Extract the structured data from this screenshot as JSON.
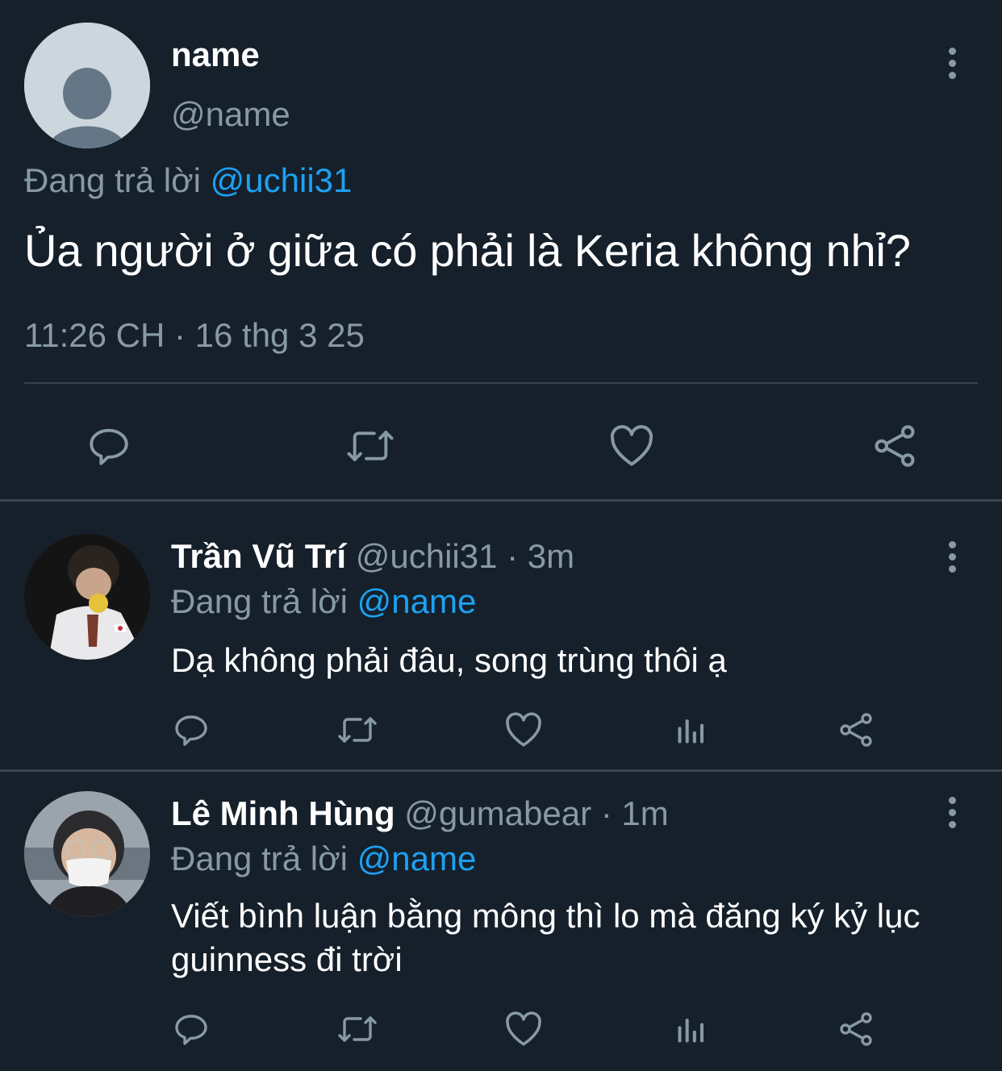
{
  "main_tweet": {
    "display_name": "name",
    "handle": "@name",
    "replying_prefix": "Đang trả lời",
    "replying_to": "@uchii31",
    "text": "Ủa người ở giữa có phải là Keria không nhỉ?",
    "timestamp": "11:26 CH · 16 thg 3 25",
    "actions": [
      "reply-icon",
      "retweet-icon",
      "like-icon",
      "share-icon"
    ]
  },
  "replies": [
    {
      "display_name": "Trần Vũ Trí",
      "handle": "@uchii31",
      "time": "· 3m",
      "replying_prefix": "Đang trả lời",
      "replying_to": "@name",
      "text": "Dạ không phải đâu, song trùng thôi ạ",
      "actions": [
        "reply-icon",
        "retweet-icon",
        "like-icon",
        "analytics-icon",
        "share-icon"
      ]
    },
    {
      "display_name": "Lê Minh Hùng",
      "handle": "@gumabear",
      "time": "· 1m",
      "replying_prefix": "Đang trả lời",
      "replying_to": "@name",
      "text": "Viết bình luận bằng mông thì lo mà đăng ký kỷ lục guinness đi trời",
      "actions": [
        "reply-icon",
        "retweet-icon",
        "like-icon",
        "analytics-icon",
        "share-icon"
      ]
    }
  ],
  "colors": {
    "background": "#15202b",
    "text": "#ffffff",
    "muted": "#8899a6",
    "link": "#1da1f2",
    "divider": "#38444d"
  }
}
